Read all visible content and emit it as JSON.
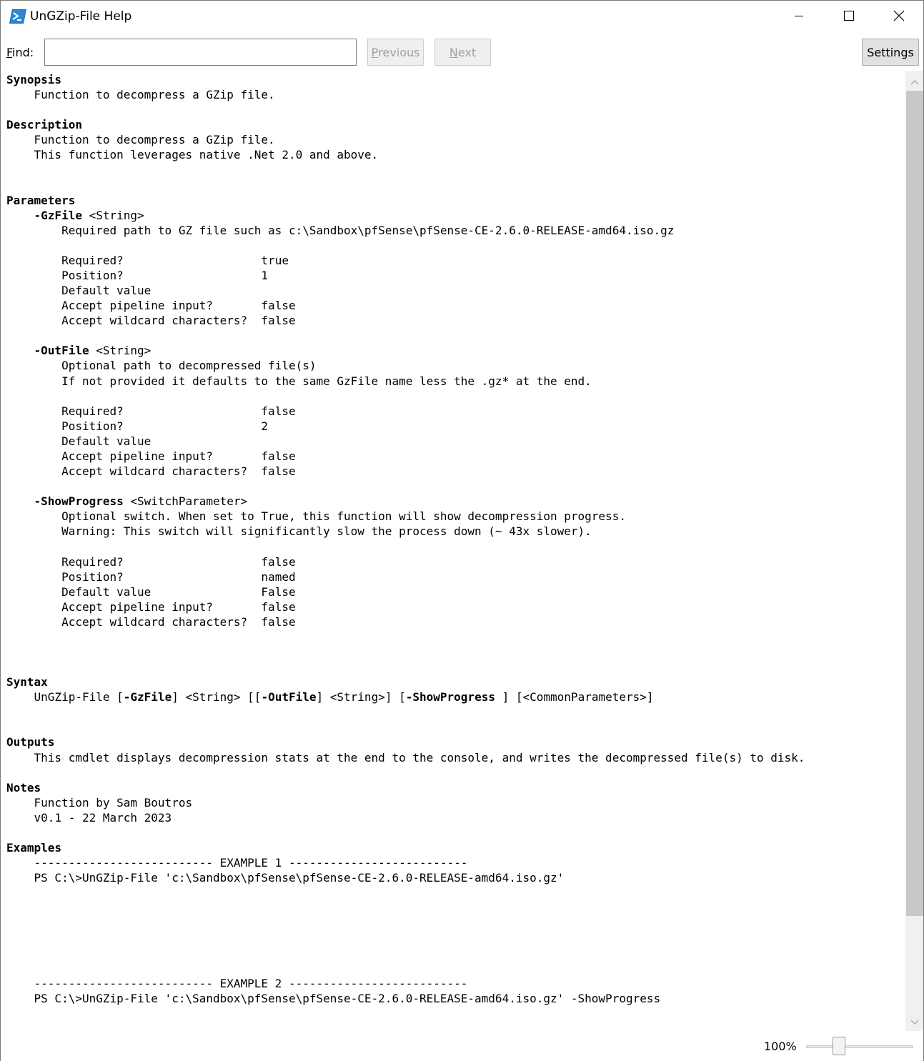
{
  "window": {
    "title": "UnGZip-File Help",
    "minimize_label": "Minimize",
    "maximize_label": "Maximize",
    "close_label": "Close"
  },
  "find": {
    "label_prefix": "F",
    "label_rest": "ind:",
    "value": "",
    "placeholder": "",
    "previous_prefix": "P",
    "previous_rest": "revious",
    "next_prefix": "N",
    "next_rest": "ext",
    "settings_label": "Settings"
  },
  "help": {
    "synopsis_heading": "Synopsis",
    "synopsis_text": "    Function to decompress a GZip file.",
    "description_heading": "Description",
    "description_lines": [
      "    Function to decompress a GZip file.",
      "    This function leverages native .Net 2.0 and above."
    ],
    "parameters_heading": "Parameters",
    "parameters": [
      {
        "name": "-GzFile",
        "type": " <String>",
        "description": [
          "        Required path to GZ file such as c:\\Sandbox\\pfSense\\pfSense-CE-2.6.0-RELEASE-amd64.iso.gz"
        ],
        "attributes": [
          {
            "key": "        Required?                    ",
            "value": "true"
          },
          {
            "key": "        Position?                    ",
            "value": "1"
          },
          {
            "key": "        Default value",
            "value": ""
          },
          {
            "key": "        Accept pipeline input?       ",
            "value": "false"
          },
          {
            "key": "        Accept wildcard characters?  ",
            "value": "false"
          }
        ]
      },
      {
        "name": "-OutFile",
        "type": " <String>",
        "description": [
          "        Optional path to decompressed file(s)",
          "        If not provided it defaults to the same GzFile name less the .gz* at the end."
        ],
        "attributes": [
          {
            "key": "        Required?                    ",
            "value": "false"
          },
          {
            "key": "        Position?                    ",
            "value": "2"
          },
          {
            "key": "        Default value",
            "value": ""
          },
          {
            "key": "        Accept pipeline input?       ",
            "value": "false"
          },
          {
            "key": "        Accept wildcard characters?  ",
            "value": "false"
          }
        ]
      },
      {
        "name": "-ShowProgress",
        "type": " <SwitchParameter>",
        "description": [
          "        Optional switch. When set to True, this function will show decompression progress.",
          "        Warning: This switch will significantly slow the process down (~ 43x slower)."
        ],
        "attributes": [
          {
            "key": "        Required?                    ",
            "value": "false"
          },
          {
            "key": "        Position?                    ",
            "value": "named"
          },
          {
            "key": "        Default value                ",
            "value": "False"
          },
          {
            "key": "        Accept pipeline input?       ",
            "value": "false"
          },
          {
            "key": "        Accept wildcard characters?  ",
            "value": "false"
          }
        ]
      }
    ],
    "syntax_heading": "Syntax",
    "syntax_parts": [
      {
        "text": "    UnGZip-File [",
        "bold": false
      },
      {
        "text": "-GzFile",
        "bold": true
      },
      {
        "text": "] <String> [[",
        "bold": false
      },
      {
        "text": "-OutFile",
        "bold": true
      },
      {
        "text": "] <String>] [",
        "bold": false
      },
      {
        "text": "-ShowProgress",
        "bold": true
      },
      {
        "text": " ] [<CommonParameters>]",
        "bold": false
      }
    ],
    "outputs_heading": "Outputs",
    "outputs_text": "    This cmdlet displays decompression stats at the end to the console, and writes the decompressed file(s) to disk.",
    "notes_heading": "Notes",
    "notes_lines": [
      "    Function by Sam Boutros",
      "    v0.1 - 22 March 2023"
    ],
    "examples_heading": "Examples",
    "examples": [
      {
        "header": "    -------------------------- EXAMPLE 1 --------------------------",
        "command": "    PS C:\\>UnGZip-File 'c:\\Sandbox\\pfSense\\pfSense-CE-2.6.0-RELEASE-amd64.iso.gz'"
      },
      {
        "header": "    -------------------------- EXAMPLE 2 --------------------------",
        "command": "    PS C:\\>UnGZip-File 'c:\\Sandbox\\pfSense\\pfSense-CE-2.6.0-RELEASE-amd64.iso.gz' -ShowProgress"
      }
    ]
  },
  "status": {
    "zoom_label": "100%",
    "zoom_fraction": 0.28
  },
  "colors": {
    "accent": "#0078d7",
    "scrollbar_track": "#f0f0f0",
    "scrollbar_thumb": "#c8c8c8",
    "disabled_text": "#a0a0a0"
  },
  "icons": {
    "app": "powershell-icon",
    "minimize": "minimize-icon",
    "maximize": "maximize-icon",
    "close": "close-icon",
    "scroll_up": "chevron-up-icon",
    "scroll_down": "chevron-down-icon"
  }
}
